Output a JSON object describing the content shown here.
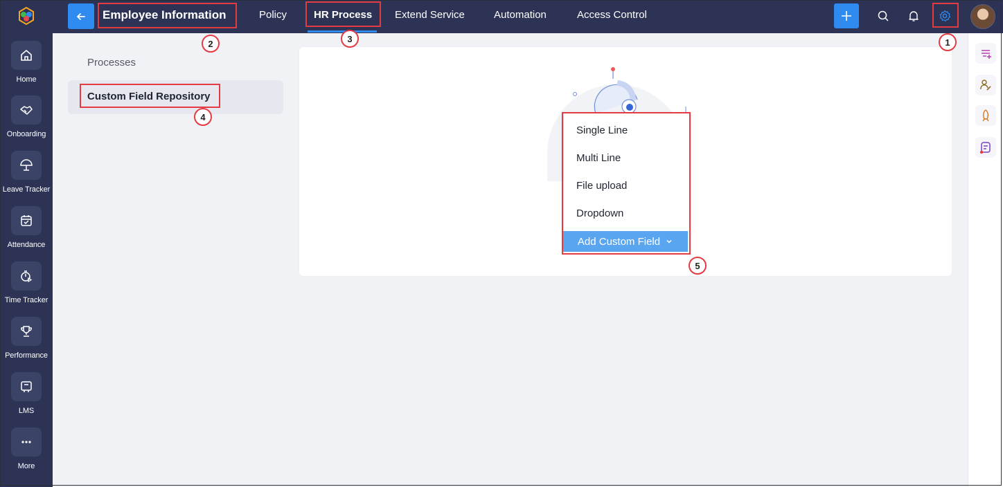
{
  "sidebar": {
    "items": [
      {
        "label": "Home",
        "icon": "home-icon"
      },
      {
        "label": "Onboarding",
        "icon": "handshake-icon"
      },
      {
        "label": "Leave Tracker",
        "icon": "umbrella-icon"
      },
      {
        "label": "Attendance",
        "icon": "calendar-check-icon"
      },
      {
        "label": "Time Tracker",
        "icon": "stopwatch-icon"
      },
      {
        "label": "Performance",
        "icon": "trophy-icon"
      },
      {
        "label": "LMS",
        "icon": "lms-board-icon"
      },
      {
        "label": "More",
        "icon": "more-dots-icon"
      }
    ]
  },
  "header": {
    "title": "Employee Information",
    "tabs": [
      "Policy",
      "HR Process",
      "Extend Service",
      "Automation",
      "Access Control"
    ],
    "active_tab": "HR Process"
  },
  "left_panel": {
    "title": "Processes",
    "selected_item": "Custom Field Repository"
  },
  "dropdown": {
    "options": [
      "Single Line",
      "Multi Line",
      "File upload",
      "Dropdown"
    ],
    "button_label": "Add Custom Field"
  },
  "annotations": [
    "1",
    "2",
    "3",
    "4",
    "5"
  ],
  "colors": {
    "nav_bg": "#2c3354",
    "accent": "#2f8bf0",
    "annotation": "#e33b41",
    "button": "#5aa5ef"
  }
}
